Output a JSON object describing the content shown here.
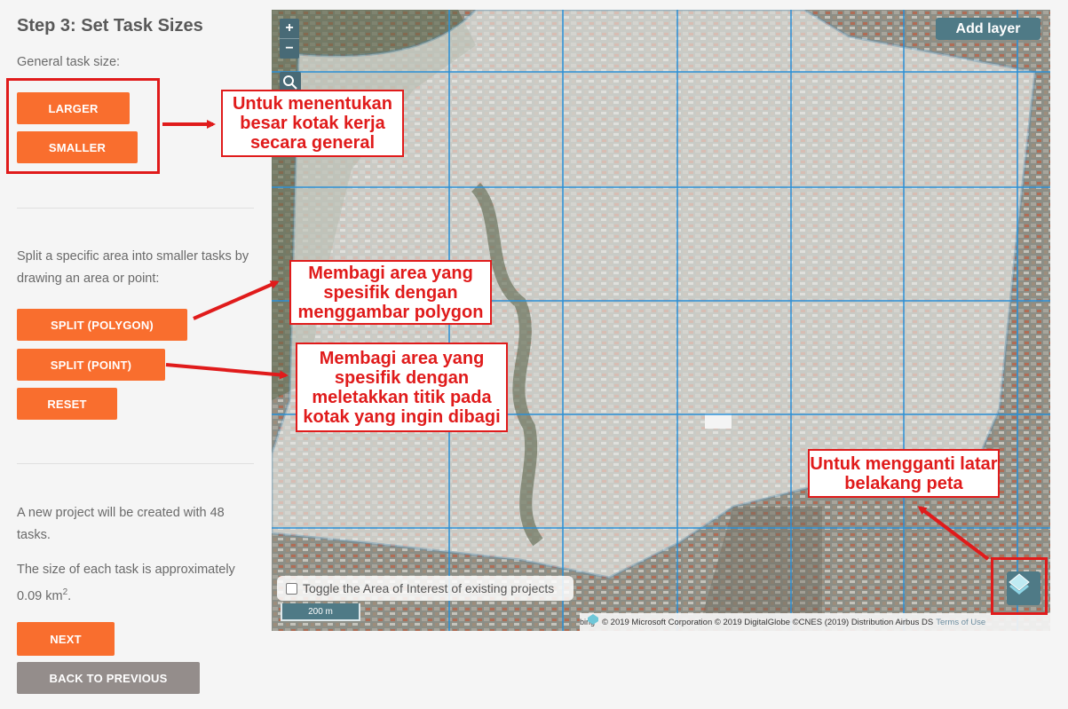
{
  "panel": {
    "title": "Step 3: Set Task Sizes",
    "general_label": "General task size:",
    "buttons": {
      "larger": "LARGER",
      "smaller": "SMALLER",
      "split_polygon": "SPLIT (POLYGON)",
      "split_point": "SPLIT (POINT)",
      "reset": "RESET",
      "next": "NEXT",
      "back": "BACK TO PREVIOUS"
    },
    "split_text": "Split a specific area into smaller tasks by drawing an area or point:",
    "info_tasks": "A new project will be created with 48 tasks.",
    "info_size_prefix": "The size of each task is approximately 0.09 km",
    "info_size_sup": "2",
    "info_size_suffix": "."
  },
  "map": {
    "zoom_in": "+",
    "zoom_out": "−",
    "add_layer": "Add layer",
    "toggle_label": "Toggle the Area of Interest of existing projects",
    "scale": "200 m",
    "bing": "bing",
    "attribution": "© 2019 Microsoft Corporation © 2019 DigitalGlobe ©CNES (2019) Distribution Airbus DS",
    "terms": "Terms of Use"
  },
  "annotations": {
    "general": "Untuk menentukan besar kotak kerja secara general",
    "polygon": "Membagi area yang spesifik dengan menggambar polygon",
    "point": "Membagi area yang spesifik dengan meletakkan titik pada kotak yang ingin dibagi",
    "basemap": "Untuk mengganti latar belakang peta"
  },
  "colors": {
    "accent": "#f96e2e",
    "secondary": "#948d8b",
    "map_control": "#4f7a86",
    "annotation_red": "#e01b1b",
    "grid_blue": "#2a8fd6"
  },
  "icons": {
    "search": "search-icon",
    "layers": "layers-icon",
    "bing": "bing-logo-icon"
  }
}
